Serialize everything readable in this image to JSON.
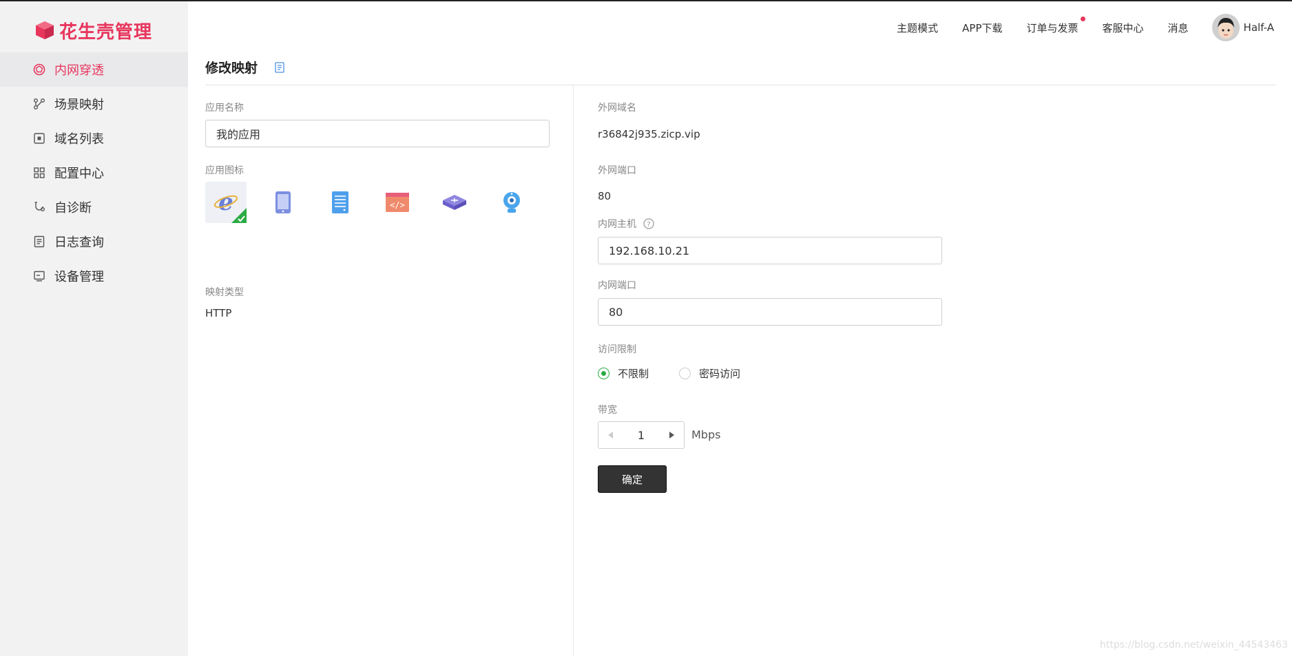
{
  "brand": {
    "name": "花生壳管理",
    "accent": "#e8365d"
  },
  "sidebar": {
    "items": [
      {
        "label": "内网穿透",
        "icon": "network-icon",
        "active": true
      },
      {
        "label": "场景映射",
        "icon": "share-nodes-icon"
      },
      {
        "label": "域名列表",
        "icon": "domain-list-icon"
      },
      {
        "label": "配置中心",
        "icon": "grid-icon"
      },
      {
        "label": "自诊断",
        "icon": "diagnose-icon"
      },
      {
        "label": "日志查询",
        "icon": "log-icon"
      },
      {
        "label": "设备管理",
        "icon": "device-icon"
      }
    ]
  },
  "header": {
    "links": [
      "主题模式",
      "APP下载",
      "订单与发票",
      "客服中心",
      "消息"
    ],
    "username": "Half-A"
  },
  "page": {
    "title": "修改映射"
  },
  "left": {
    "app_name_label": "应用名称",
    "app_name_value": "我的应用",
    "app_icon_label": "应用图标",
    "icons": [
      "ie-browser-icon",
      "tablet-icon",
      "server-icon",
      "code-window-icon",
      "router-icon",
      "webcam-icon"
    ],
    "selected_icon": "ie-browser-icon",
    "mapping_type_label": "映射类型",
    "mapping_type_value": "HTTP"
  },
  "right": {
    "ext_domain_label": "外网域名",
    "ext_domain_value": "r36842j935.zicp.vip",
    "ext_port_label": "外网端口",
    "ext_port_value": "80",
    "int_host_label": "内网主机",
    "int_host_value": "192.168.10.21",
    "int_port_label": "内网端口",
    "int_port_value": "80",
    "access_label": "访问限制",
    "access_options": [
      "不限制",
      "密码访问"
    ],
    "access_selected": "不限制",
    "bandwidth_label": "带宽",
    "bandwidth_value": "1",
    "bandwidth_unit": "Mbps",
    "confirm_label": "确定"
  },
  "watermark": "https://blog.csdn.net/weixin_44543463"
}
